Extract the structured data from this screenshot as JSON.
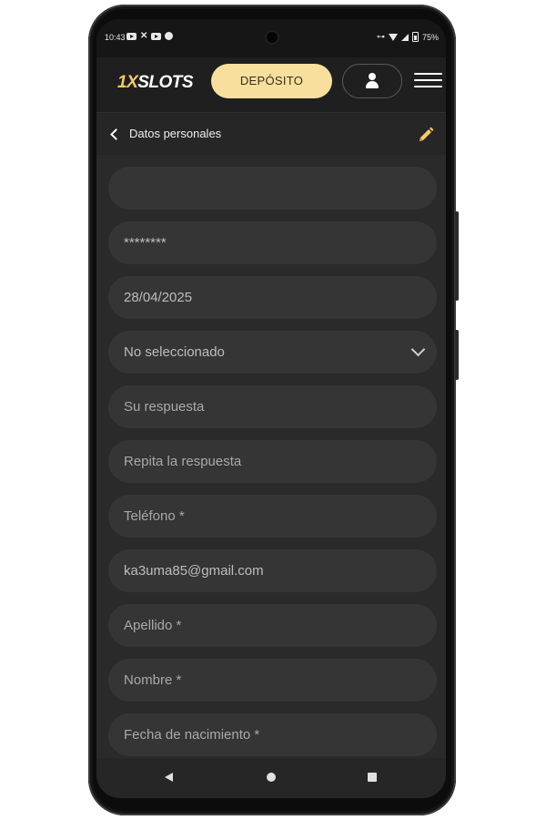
{
  "status_bar": {
    "time": "10:43",
    "notification_icons": [
      "youtube-icon",
      "x-icon",
      "youtube-icon",
      "motorola-icon"
    ],
    "battery": "75%"
  },
  "header": {
    "logo_prefix": "1X",
    "logo_suffix": "SLOTS",
    "deposit_label": "DEPÓSITO",
    "brand_color": "#f5c96a",
    "deposit_color": "#f8df9e"
  },
  "subheader": {
    "title": "Datos personales"
  },
  "form": {
    "fields": [
      {
        "name": "blank-field",
        "text": "",
        "kind": "value"
      },
      {
        "name": "password-field",
        "text": "********",
        "kind": "value"
      },
      {
        "name": "registration-date-field",
        "text": "28/04/2025",
        "kind": "value"
      },
      {
        "name": "secret-question-select",
        "text": "No seleccionado",
        "kind": "select"
      },
      {
        "name": "answer-field",
        "text": "Su respuesta",
        "kind": "placeholder"
      },
      {
        "name": "repeat-answer-field",
        "text": "Repita la respuesta",
        "kind": "placeholder"
      },
      {
        "name": "phone-field",
        "text": "Teléfono *",
        "kind": "placeholder"
      },
      {
        "name": "email-field",
        "text": "ka3uma85@gmail.com",
        "kind": "value"
      },
      {
        "name": "surname-field",
        "text": "Apellido *",
        "kind": "placeholder"
      },
      {
        "name": "first-name-field",
        "text": "Nombre *",
        "kind": "placeholder"
      },
      {
        "name": "birth-date-field",
        "text": "Fecha de nacimiento *",
        "kind": "placeholder"
      }
    ]
  },
  "colors": {
    "background": "#262626",
    "field_background": "#353535",
    "accent": "#f5c96a"
  }
}
